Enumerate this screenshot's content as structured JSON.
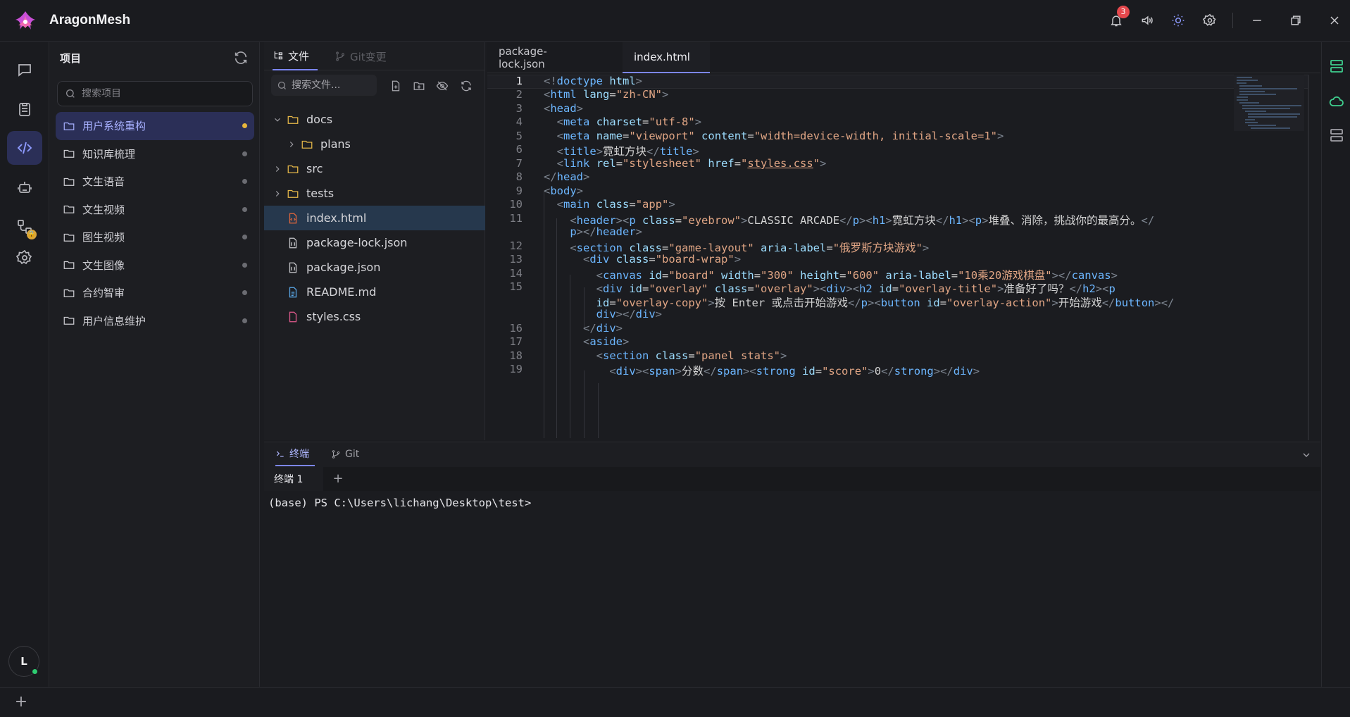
{
  "app": {
    "title": "AragonMesh",
    "notifications_count": "3"
  },
  "projects": {
    "title": "项目",
    "search_placeholder": "搜索项目",
    "items": [
      {
        "label": "用户系统重构",
        "active": true
      },
      {
        "label": "知识库梳理"
      },
      {
        "label": "文生语音"
      },
      {
        "label": "文生视频"
      },
      {
        "label": "图生视频"
      },
      {
        "label": "文生图像"
      },
      {
        "label": "合约智审"
      },
      {
        "label": "用户信息维护"
      }
    ]
  },
  "files": {
    "tab_files": "文件",
    "tab_git": "Git变更",
    "search_placeholder": "搜索文件...",
    "tree": [
      {
        "name": "docs",
        "type": "folder",
        "expanded": true
      },
      {
        "name": "plans",
        "type": "folder"
      },
      {
        "name": "src",
        "type": "folder"
      },
      {
        "name": "tests",
        "type": "folder"
      },
      {
        "name": "index.html",
        "type": "html",
        "active": true
      },
      {
        "name": "package-lock.json",
        "type": "json"
      },
      {
        "name": "package.json",
        "type": "json"
      },
      {
        "name": "README.md",
        "type": "md"
      },
      {
        "name": "styles.css",
        "type": "css"
      }
    ]
  },
  "editor": {
    "tabs": [
      {
        "label": "package-lock.json"
      },
      {
        "label": "index.html",
        "active": true
      }
    ],
    "line_numbers": [
      "1",
      "2",
      "3",
      "4",
      "5",
      "6",
      "7",
      "8",
      "9",
      "10",
      "11",
      "",
      "12",
      "13",
      "14",
      "15",
      "",
      "",
      "16",
      "17",
      "18",
      "19"
    ],
    "current_line": "1"
  },
  "terminal": {
    "tab_terminal": "终端",
    "tab_git": "Git",
    "session_tab": "终端 1",
    "add_label": "+",
    "prompt": "(base) PS C:\\Users\\lichang\\Desktop\\test>"
  },
  "user": {
    "initial": "L"
  },
  "status": {
    "add_label": "+"
  },
  "colors": {
    "accent": "#7c86ff",
    "active_bg": "#2b2f57",
    "badge": "#e5484d",
    "online": "#2ecc71"
  }
}
